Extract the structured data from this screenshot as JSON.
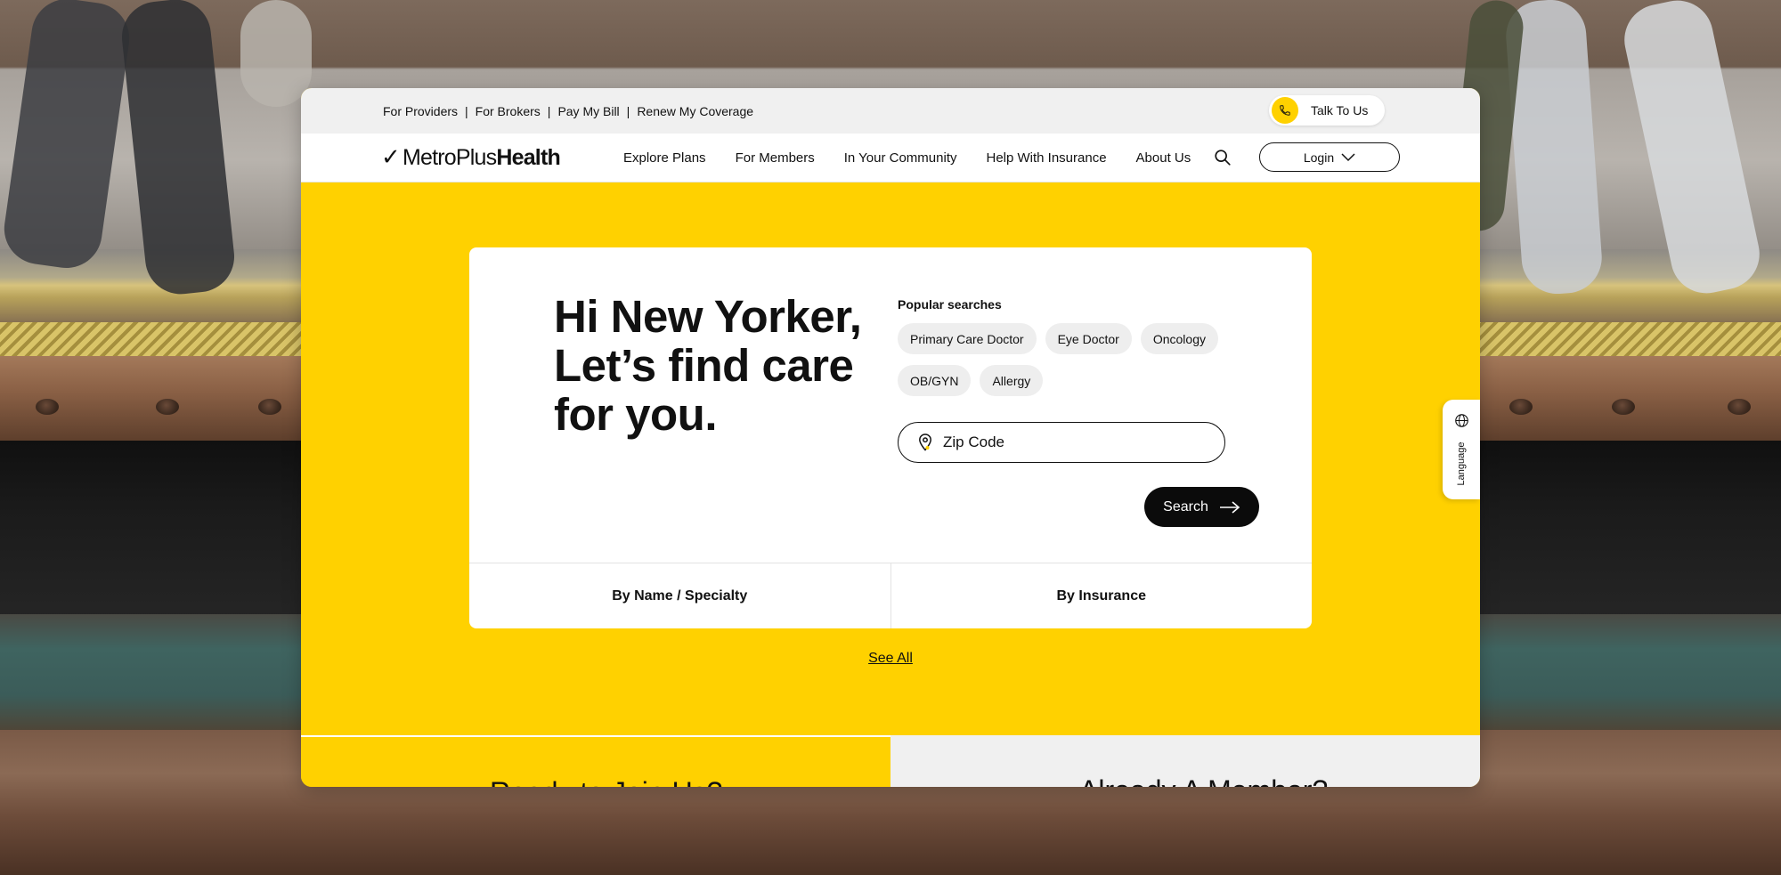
{
  "utility": {
    "links": [
      "For Providers",
      "For Brokers",
      "Pay My Bill",
      "Renew My Coverage"
    ],
    "talk_label": "Talk To Us"
  },
  "brand": {
    "logo_light": "MetroPlus",
    "logo_bold": "Health"
  },
  "nav": {
    "items": [
      "Explore Plans",
      "For Members",
      "In Your Community",
      "Help With Insurance",
      "About Us"
    ],
    "login_label": "Login"
  },
  "hero": {
    "headline_line1": "Hi New Yorker,",
    "headline_line2": "Let’s find care",
    "headline_line3": "for you.",
    "popular_title": "Popular searches",
    "chips": [
      "Primary Care Doctor",
      "Eye Doctor",
      "Oncology",
      "OB/GYN",
      "Allergy"
    ],
    "zip_placeholder": "Zip Code",
    "search_label": "Search",
    "tabs": [
      "By Name / Specialty",
      "By Insurance"
    ],
    "see_all": "See All"
  },
  "bottom": {
    "left_title": "Ready to Join Us?",
    "right_title": "Already A Member?"
  },
  "language_label": "Language",
  "colors": {
    "accent": "#ffd100",
    "dark": "#0b0b0b",
    "utility_bg": "#f0f0f0"
  }
}
